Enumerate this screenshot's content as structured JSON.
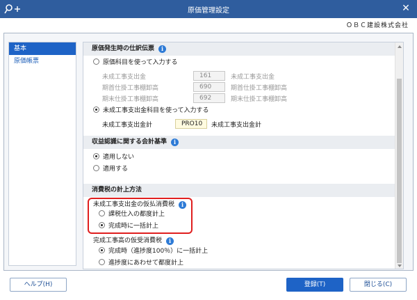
{
  "window": {
    "title": "原価管理設定",
    "app_icon": "key-plus-icon",
    "close_icon": "close-icon"
  },
  "company": "ＯＢＣ建設株式会社",
  "sidebar": {
    "items": [
      {
        "label": "基本"
      },
      {
        "label": "原価帳票"
      }
    ]
  },
  "section1": {
    "title": "原価発生時の仕訳伝票",
    "option_a": "原価科目を使って入力する",
    "rows": [
      {
        "label": "未成工事支出金",
        "code": "161",
        "name": "未成工事支出金"
      },
      {
        "label": "期首仕掛工事棚卸高",
        "code": "690",
        "name": "期首仕掛工事棚卸高"
      },
      {
        "label": "期末仕掛工事棚卸高",
        "code": "692",
        "name": "期末仕掛工事棚卸高"
      }
    ],
    "option_b": "未成工事支出金科目を使って入力する",
    "total": {
      "label": "未成工事支出金計",
      "code": "PRO10",
      "name": "未成工事支出金計"
    },
    "selected": "option_b"
  },
  "section2": {
    "title": "収益認識に関する会計基準",
    "option_a": "適用しない",
    "option_b": "適用する",
    "selected": "option_a"
  },
  "section3": {
    "title": "消費税の計上方法",
    "group1": {
      "label": "未成工事支出金の仮払消費税",
      "option_a": "課税仕入の都度計上",
      "option_b": "完成時に一括計上",
      "selected": "option_b"
    },
    "group2": {
      "label": "完成工事高の仮受消費税",
      "option_a": "完成時（進捗度100％）に一括計上",
      "option_b": "進捗度にあわせて都度計上",
      "selected": "option_a"
    }
  },
  "footer": {
    "help": "ヘルプ(H)",
    "register": "登録(T)",
    "close": "閉じる(C)"
  },
  "colors": {
    "titlebar": "#2f5d9e",
    "accent": "#1e63c6",
    "highlight_border": "#e01e1e"
  }
}
